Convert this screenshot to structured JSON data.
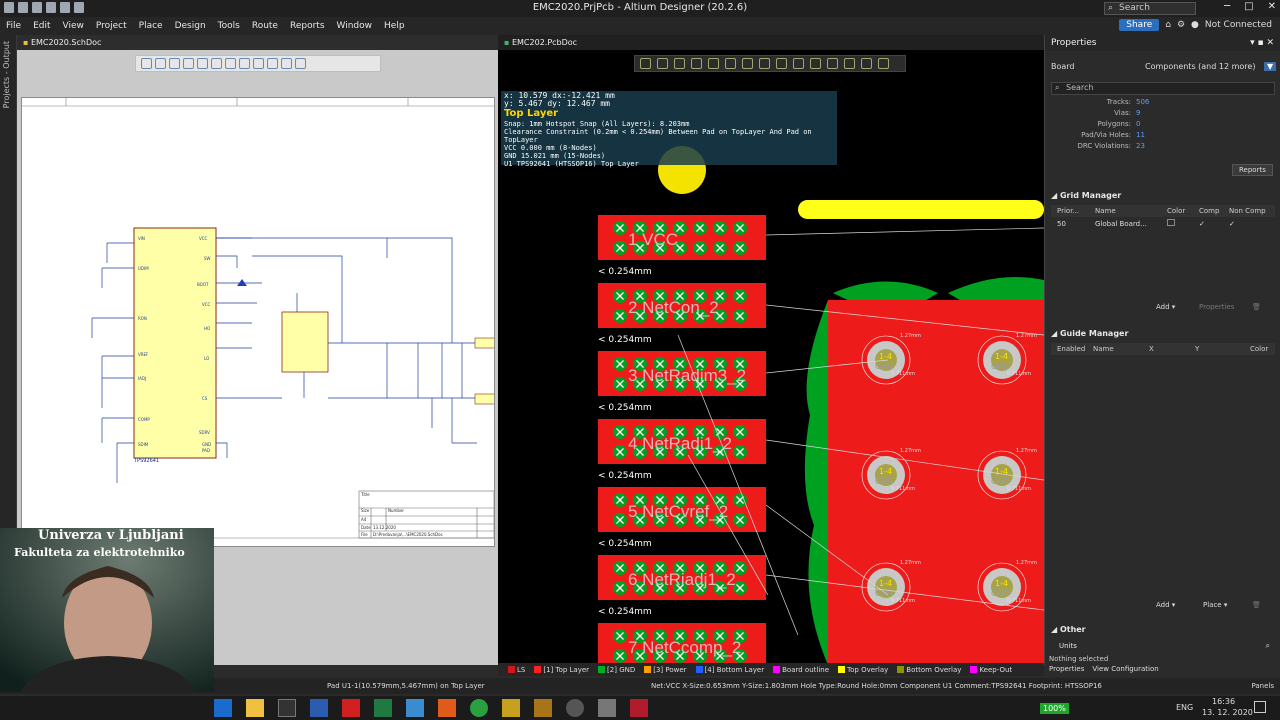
{
  "window": {
    "title": "EMC2020.PrjPcb - Altium Designer (20.2.6)",
    "search": "Search",
    "share": "Share",
    "connection": "Not Connected"
  },
  "menu": [
    "File",
    "Edit",
    "View",
    "Project",
    "Place",
    "Design",
    "Tools",
    "Route",
    "Reports",
    "Window",
    "Help"
  ],
  "left_panel_label": "Projects - Output",
  "schematic": {
    "tab": "EMC2020.SchDoc",
    "ic_label": "TPS92641",
    "title_block": {
      "title": "Title",
      "size_label": "Size",
      "size": "A4",
      "number_label": "Number",
      "date_label": "Date",
      "date": "13.12.2020",
      "file_label": "File",
      "file": "D:\\Predavanja\\...\\EMC2020.SchDoc"
    }
  },
  "pcb": {
    "tab": "EMC202.PcbDoc",
    "hud": {
      "xy1": "x: 10.579   dx:-12.421 mm",
      "xy2": "y:  5.467   dy: 12.467 mm",
      "layer": "Top Layer",
      "l1": "Snap: 1mm Hotspot Snap (All Layers): 8.203mm",
      "l2": "Clearance Constraint (0.2mm < 0.254mm) Between Pad on TopLayer And Pad on TopLayer",
      "l3": "VCC  0.000 mm (8-Nodes)",
      "l4": "GND  15.021 mm (15-Nodes)",
      "l5": "U1  TPS92641 (HTSSOP16) Top Layer"
    },
    "pads": [
      {
        "net": "1  VCC",
        "clearance": "< 0.254mm"
      },
      {
        "net": "2  NetCon_2",
        "clearance": "< 0.254mm"
      },
      {
        "net": "3  NetRadim3_2",
        "clearance": "< 0.254mm"
      },
      {
        "net": "4  NetRadi1_2",
        "clearance": "< 0.254mm"
      },
      {
        "net": "5  NetCvref_2",
        "clearance": "< 0.254mm"
      },
      {
        "net": "6  NetRiadj1_2",
        "clearance": "< 0.254mm"
      },
      {
        "net": "7  NetCcomp_2",
        "clearance": ""
      }
    ],
    "big_pads": {
      "label": "1-4",
      "net": "GND",
      "hole": "0.711mm",
      "dim": "1.27mm"
    }
  },
  "properties": {
    "header": "Properties",
    "scope": "Board",
    "filter": "Components (and 12 more)",
    "search": "Search",
    "stats": [
      {
        "label": "Tracks:",
        "value": "506"
      },
      {
        "label": "Vias:",
        "value": "9"
      },
      {
        "label": "Polygons:",
        "value": "0"
      },
      {
        "label": "Pad/Via Holes:",
        "value": "11"
      },
      {
        "label": "DRC Violations:",
        "value": "23"
      }
    ],
    "reports": "Reports",
    "grid_manager": "Grid Manager",
    "grid_cols": [
      "Prior...",
      "Name",
      "Color",
      "Comp",
      "Non Comp"
    ],
    "grid_row": {
      "prior": "50",
      "name": "Global Board..."
    },
    "add": "Add",
    "props_btn": "Properties",
    "guide_manager": "Guide Manager",
    "guide_cols": [
      "Enabled",
      "Name",
      "X",
      "Y",
      "Color"
    ],
    "add2": "Add",
    "place": "Place",
    "other": "Other",
    "units": "Units",
    "nothing_selected": "Nothing selected",
    "bottom_tabs": [
      "Properties",
      "View Configuration"
    ]
  },
  "layers": [
    {
      "name": "LS",
      "color": "#d0181a"
    },
    {
      "name": "[1] Top Layer",
      "color": "#ff2020"
    },
    {
      "name": "[2] GND",
      "color": "#00b020"
    },
    {
      "name": "[3] Power",
      "color": "#ffa000"
    },
    {
      "name": "[4] Bottom Layer",
      "color": "#2060ff"
    },
    {
      "name": "Board outline",
      "color": "#ff00ff"
    },
    {
      "name": "Top Overlay",
      "color": "#ffff00"
    },
    {
      "name": "Bottom Overlay",
      "color": "#909000"
    },
    {
      "name": "Keep-Out",
      "color": "#ff00ff"
    }
  ],
  "status": {
    "left": "Pad U1-1(10.579mm,5.467mm) on Top Layer",
    "mid": "Net:VCC X-Size:0.653mm Y-Size:1.803mm Hole Type:Round Hole:0mm   Component U1 Comment:TPS92641 Footprint: HTSSOP16",
    "panels": "Panels"
  },
  "taskbar": {
    "zoom": "100%",
    "lang": "ENG",
    "time": "16:36",
    "date": "13. 12. 2020"
  },
  "webcam": {
    "caption1": "Univerza v Ljubljani",
    "caption2": "Fakulteta za elektrotehniko"
  }
}
